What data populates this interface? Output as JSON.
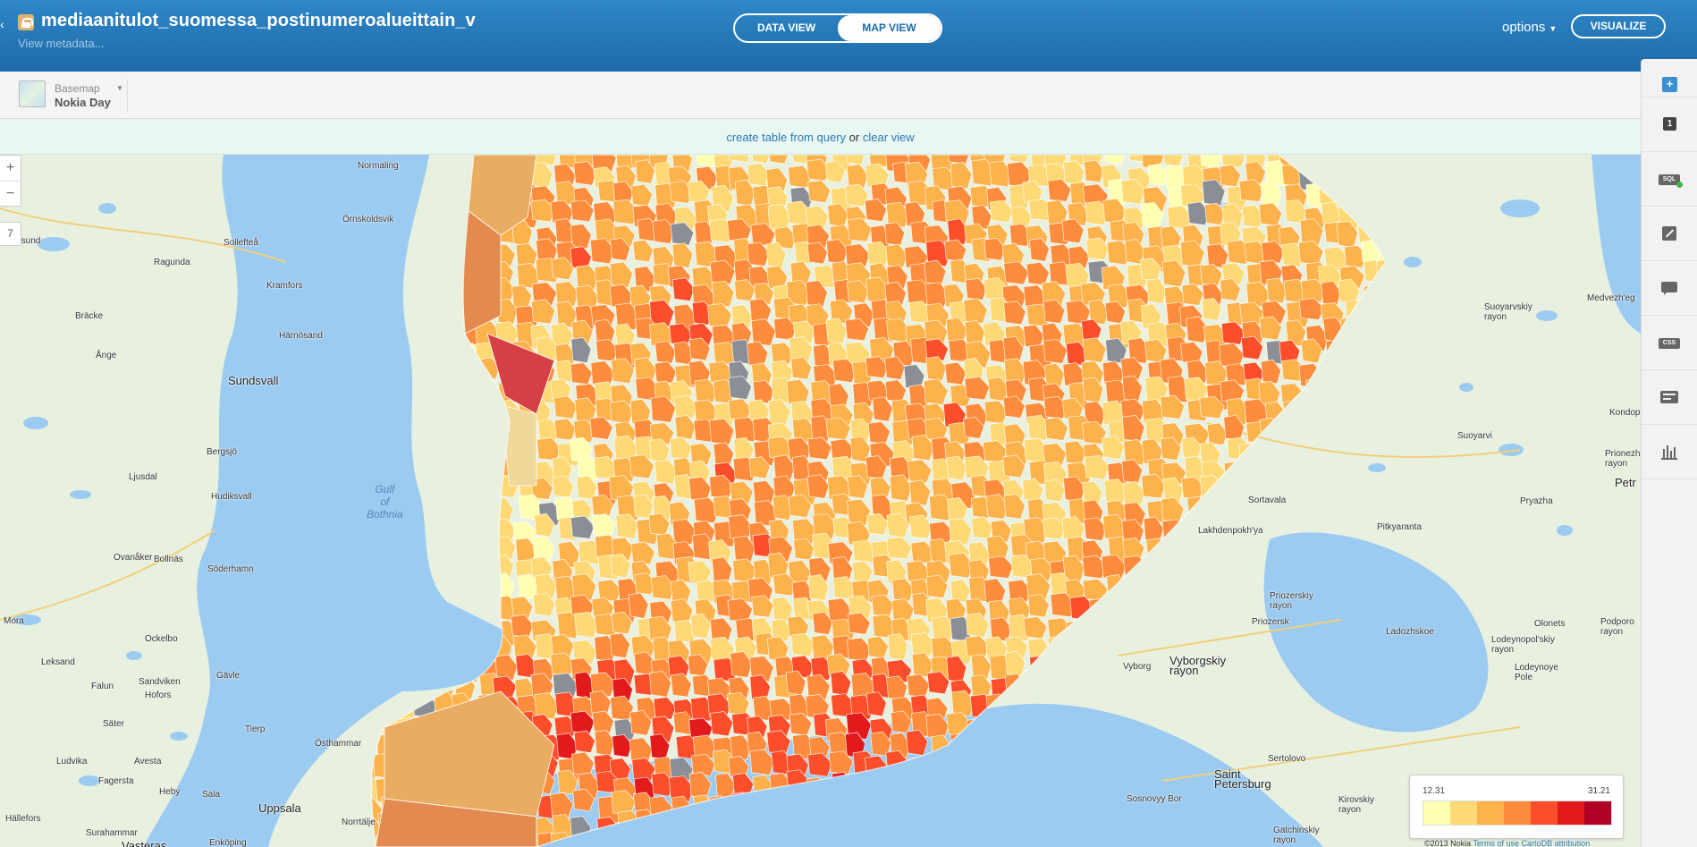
{
  "header": {
    "table_title": "mediaanitulot_suomessa_postinumeroalueittain_v",
    "view_metadata": "View metadata...",
    "tabs": [
      {
        "label": "DATA VIEW",
        "active": false
      },
      {
        "label": "MAP VIEW",
        "active": true
      }
    ],
    "options_label": "options",
    "visualize_label": "VISUALIZE"
  },
  "toolbar": {
    "basemap_label": "Basemap",
    "basemap_value": "Nokia Day"
  },
  "query_bar": {
    "create_link": "create table from query",
    "or_text": "or",
    "clear_link": "clear view"
  },
  "map": {
    "zoom_in": "+",
    "zoom_out": "−",
    "zoom_level": "7",
    "labels": {
      "normaling": "Normaling",
      "ornskoldsvik": "Örnskoldsvik",
      "ostersund": "tersund",
      "solleftea": "Sollefteå",
      "ragunda": "Ragunda",
      "kramfors": "Kramfors",
      "bracke": "Bräcke",
      "harnosand": "Härnösand",
      "ange": "Ånge",
      "sundsvall": "Sundsvall",
      "bergsjo": "Bergsjö",
      "ljusdal": "Ljusdal",
      "hudiksvall": "Hudiksvall",
      "gulf": "Gulf\nof\nBothnia",
      "ovanaker": "Ovanåker",
      "bollnas": "Bollnäs",
      "soderhamn": "Söderhamn",
      "mora": "Mora",
      "ockelbo": "Ockelbo",
      "leksand": "Leksand",
      "sandviken": "Sandviken",
      "falun": "Falun",
      "hofors": "Hofors",
      "gavle": "Gävle",
      "sater": "Säter",
      "tierp": "Tierp",
      "osthammar": "Östhammar",
      "ludvika": "Ludvika",
      "avesta": "Avesta",
      "fagersta": "Fagersta",
      "sala": "Sala",
      "heby": "Heby",
      "uppsala": "Uppsala",
      "hallefors": "Hällefors",
      "norrtalje": "Norrtälje",
      "surahammar": "Surahammar",
      "vasteras": "Vasteras",
      "enkoping": "Enköping",
      "suoyarvsky": "Suoyarvskiy\nrayon",
      "suoyarvi": "Suoyarvi",
      "medvezh": "Medvezh'eg",
      "kondopoga": "Kondop",
      "prionezh": "Prionezh\nrayon",
      "petro": "Petr",
      "sortavala": "Sortavala",
      "pitkyaranta": "Pitkyaranta",
      "pryazha": "Pryazha",
      "lakhdenpokhya": "Lakhdenpokh'ya",
      "priozersky": "Priozerskiy\nrayon",
      "priozersk": "Priozersk",
      "ladozhskoe": "Ladozhskoe",
      "olonets": "Olonets",
      "lodeynopolsky": "Lodeynopol'skiy\nrayon",
      "lodeynoye": "Lodeynoye\nPole",
      "podporozh": "Podporo\nrayon",
      "vyborg": "Vyborg",
      "vyborgsky": "Vyborgskiy\nrayon",
      "sertolovo": "Sertolovo",
      "saint_petersburg": "Saint\nPetersburg",
      "sosnovy_bor": "Sosnovyy Bor",
      "kirovsky": "Kirovskiy\nrayon",
      "gatchinsky": "Gatchinskiy\nrayon"
    }
  },
  "legend": {
    "min": "12.31",
    "max": "31.21",
    "colors": [
      "#ffffb2",
      "#fed976",
      "#feb24c",
      "#fd8d3c",
      "#fc4e2a",
      "#e31a1c",
      "#b10026"
    ]
  },
  "attribution": {
    "text": "©2013 Nokia",
    "terms": "Terms of use",
    "cartodb": "CartoDB attribution"
  },
  "side_panel": {
    "icons": [
      "add-layer-icon",
      "layer-number-icon",
      "sql-icon",
      "wizard-icon",
      "infowindow-icon",
      "css-icon",
      "legends-icon",
      "filters-icon"
    ],
    "layer_number": "1"
  }
}
